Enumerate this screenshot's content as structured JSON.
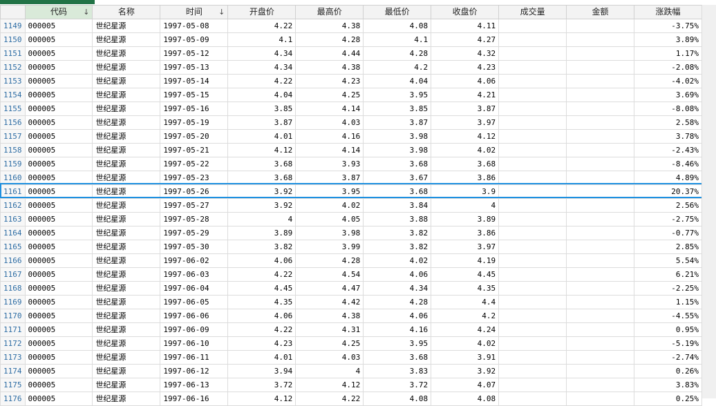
{
  "headers": {
    "code": "代码",
    "name": "名称",
    "date": "时间",
    "open": "开盘价",
    "high": "最高价",
    "low": "最低价",
    "close": "收盘价",
    "volume": "成交量",
    "amount": "金额",
    "change": "涨跌幅",
    "sort_icon": "↓"
  },
  "rows": [
    {
      "rn": "1149",
      "code": "000005",
      "name": "世纪星源",
      "date": "1997-05-08",
      "open": "4.22",
      "high": "4.38",
      "low": "4.08",
      "close": "4.11",
      "volume": "",
      "amount": "",
      "change": "-3.75%"
    },
    {
      "rn": "1150",
      "code": "000005",
      "name": "世纪星源",
      "date": "1997-05-09",
      "open": "4.1",
      "high": "4.28",
      "low": "4.1",
      "close": "4.27",
      "volume": "",
      "amount": "",
      "change": "3.89%"
    },
    {
      "rn": "1151",
      "code": "000005",
      "name": "世纪星源",
      "date": "1997-05-12",
      "open": "4.34",
      "high": "4.44",
      "low": "4.28",
      "close": "4.32",
      "volume": "",
      "amount": "",
      "change": "1.17%"
    },
    {
      "rn": "1152",
      "code": "000005",
      "name": "世纪星源",
      "date": "1997-05-13",
      "open": "4.34",
      "high": "4.38",
      "low": "4.2",
      "close": "4.23",
      "volume": "",
      "amount": "",
      "change": "-2.08%"
    },
    {
      "rn": "1153",
      "code": "000005",
      "name": "世纪星源",
      "date": "1997-05-14",
      "open": "4.22",
      "high": "4.23",
      "low": "4.04",
      "close": "4.06",
      "volume": "",
      "amount": "",
      "change": "-4.02%"
    },
    {
      "rn": "1154",
      "code": "000005",
      "name": "世纪星源",
      "date": "1997-05-15",
      "open": "4.04",
      "high": "4.25",
      "low": "3.95",
      "close": "4.21",
      "volume": "",
      "amount": "",
      "change": "3.69%"
    },
    {
      "rn": "1155",
      "code": "000005",
      "name": "世纪星源",
      "date": "1997-05-16",
      "open": "3.85",
      "high": "4.14",
      "low": "3.85",
      "close": "3.87",
      "volume": "",
      "amount": "",
      "change": "-8.08%"
    },
    {
      "rn": "1156",
      "code": "000005",
      "name": "世纪星源",
      "date": "1997-05-19",
      "open": "3.87",
      "high": "4.03",
      "low": "3.87",
      "close": "3.97",
      "volume": "",
      "amount": "",
      "change": "2.58%"
    },
    {
      "rn": "1157",
      "code": "000005",
      "name": "世纪星源",
      "date": "1997-05-20",
      "open": "4.01",
      "high": "4.16",
      "low": "3.98",
      "close": "4.12",
      "volume": "",
      "amount": "",
      "change": "3.78%"
    },
    {
      "rn": "1158",
      "code": "000005",
      "name": "世纪星源",
      "date": "1997-05-21",
      "open": "4.12",
      "high": "4.14",
      "low": "3.98",
      "close": "4.02",
      "volume": "",
      "amount": "",
      "change": "-2.43%"
    },
    {
      "rn": "1159",
      "code": "000005",
      "name": "世纪星源",
      "date": "1997-05-22",
      "open": "3.68",
      "high": "3.93",
      "low": "3.68",
      "close": "3.68",
      "volume": "",
      "amount": "",
      "change": "-8.46%"
    },
    {
      "rn": "1160",
      "code": "000005",
      "name": "世纪星源",
      "date": "1997-05-23",
      "open": "3.68",
      "high": "3.87",
      "low": "3.67",
      "close": "3.86",
      "volume": "",
      "amount": "",
      "change": "4.89%"
    },
    {
      "rn": "1161",
      "code": "000005",
      "name": "世纪星源",
      "date": "1997-05-26",
      "open": "3.92",
      "high": "3.95",
      "low": "3.68",
      "close": "3.9",
      "volume": "",
      "amount": "",
      "change": "20.37%"
    },
    {
      "rn": "1162",
      "code": "000005",
      "name": "世纪星源",
      "date": "1997-05-27",
      "open": "3.92",
      "high": "4.02",
      "low": "3.84",
      "close": "4",
      "volume": "",
      "amount": "",
      "change": "2.56%"
    },
    {
      "rn": "1163",
      "code": "000005",
      "name": "世纪星源",
      "date": "1997-05-28",
      "open": "4",
      "high": "4.05",
      "low": "3.88",
      "close": "3.89",
      "volume": "",
      "amount": "",
      "change": "-2.75%"
    },
    {
      "rn": "1164",
      "code": "000005",
      "name": "世纪星源",
      "date": "1997-05-29",
      "open": "3.89",
      "high": "3.98",
      "low": "3.82",
      "close": "3.86",
      "volume": "",
      "amount": "",
      "change": "-0.77%"
    },
    {
      "rn": "1165",
      "code": "000005",
      "name": "世纪星源",
      "date": "1997-05-30",
      "open": "3.82",
      "high": "3.99",
      "low": "3.82",
      "close": "3.97",
      "volume": "",
      "amount": "",
      "change": "2.85%"
    },
    {
      "rn": "1166",
      "code": "000005",
      "name": "世纪星源",
      "date": "1997-06-02",
      "open": "4.06",
      "high": "4.28",
      "low": "4.02",
      "close": "4.19",
      "volume": "",
      "amount": "",
      "change": "5.54%"
    },
    {
      "rn": "1167",
      "code": "000005",
      "name": "世纪星源",
      "date": "1997-06-03",
      "open": "4.22",
      "high": "4.54",
      "low": "4.06",
      "close": "4.45",
      "volume": "",
      "amount": "",
      "change": "6.21%"
    },
    {
      "rn": "1168",
      "code": "000005",
      "name": "世纪星源",
      "date": "1997-06-04",
      "open": "4.45",
      "high": "4.47",
      "low": "4.34",
      "close": "4.35",
      "volume": "",
      "amount": "",
      "change": "-2.25%"
    },
    {
      "rn": "1169",
      "code": "000005",
      "name": "世纪星源",
      "date": "1997-06-05",
      "open": "4.35",
      "high": "4.42",
      "low": "4.28",
      "close": "4.4",
      "volume": "",
      "amount": "",
      "change": "1.15%"
    },
    {
      "rn": "1170",
      "code": "000005",
      "name": "世纪星源",
      "date": "1997-06-06",
      "open": "4.06",
      "high": "4.38",
      "low": "4.06",
      "close": "4.2",
      "volume": "",
      "amount": "",
      "change": "-4.55%"
    },
    {
      "rn": "1171",
      "code": "000005",
      "name": "世纪星源",
      "date": "1997-06-09",
      "open": "4.22",
      "high": "4.31",
      "low": "4.16",
      "close": "4.24",
      "volume": "",
      "amount": "",
      "change": "0.95%"
    },
    {
      "rn": "1172",
      "code": "000005",
      "name": "世纪星源",
      "date": "1997-06-10",
      "open": "4.23",
      "high": "4.25",
      "low": "3.95",
      "close": "4.02",
      "volume": "",
      "amount": "",
      "change": "-5.19%"
    },
    {
      "rn": "1173",
      "code": "000005",
      "name": "世纪星源",
      "date": "1997-06-11",
      "open": "4.01",
      "high": "4.03",
      "low": "3.68",
      "close": "3.91",
      "volume": "",
      "amount": "",
      "change": "-2.74%"
    },
    {
      "rn": "1174",
      "code": "000005",
      "name": "世纪星源",
      "date": "1997-06-12",
      "open": "3.94",
      "high": "4",
      "low": "3.83",
      "close": "3.92",
      "volume": "",
      "amount": "",
      "change": "0.26%"
    },
    {
      "rn": "1175",
      "code": "000005",
      "name": "世纪星源",
      "date": "1997-06-13",
      "open": "3.72",
      "high": "4.12",
      "low": "3.72",
      "close": "4.07",
      "volume": "",
      "amount": "",
      "change": "3.83%"
    },
    {
      "rn": "1176",
      "code": "000005",
      "name": "世纪星源",
      "date": "1997-06-16",
      "open": "4.12",
      "high": "4.22",
      "low": "4.08",
      "close": "4.08",
      "volume": "",
      "amount": "",
      "change": "0.25%"
    }
  ],
  "colors": {
    "accent": "#217346",
    "highlight_border": "#1e90e0",
    "row_number": "#2e6da4"
  }
}
